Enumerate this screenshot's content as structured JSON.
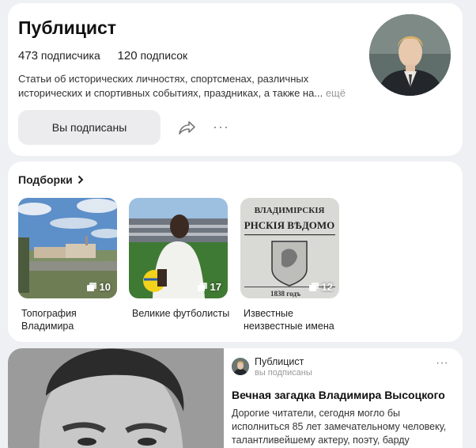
{
  "profile": {
    "title": "Публицист",
    "subscribers_count": "473",
    "subscribers_label": "подписчика",
    "subscriptions_count": "120",
    "subscriptions_label": "подписок",
    "description": "Статьи об исторических личностях, спортсменах, различных исторических и спортивных событиях, праздниках, а также на...",
    "more_label": "ещё",
    "subscribed_button": "Вы подписаны",
    "share_icon": "share-icon",
    "more_icon": "more-dots-icon"
  },
  "collections": {
    "title": "Подборки",
    "items": [
      {
        "label": "Топография Владимира",
        "count": "10",
        "icon": "collection-stack-icon"
      },
      {
        "label": "Великие футболисты",
        "count": "17",
        "icon": "collection-stack-icon"
      },
      {
        "label": "Известные неизвестные имена",
        "count": "12",
        "icon": "collection-stack-icon"
      }
    ],
    "tile3_text_line1": "ВЛАДИМІРСКІЯ",
    "tile3_text_line2": "РНСКІЯ ВѢДОМО",
    "tile3_year": "1838 годъ"
  },
  "article": {
    "author": "Публицист",
    "author_status": "вы подписаны",
    "title": "Вечная загадка Владимира Высоцкого",
    "text": "Дорогие читатели, сегодня могло бы исполниться 85 лет замечательному человеку, талантливейшему актеру, поэту, барду"
  },
  "colors": {
    "background": "#eef0f3",
    "card": "#ffffff",
    "button_bg": "#ececef",
    "muted_text": "#999999"
  }
}
